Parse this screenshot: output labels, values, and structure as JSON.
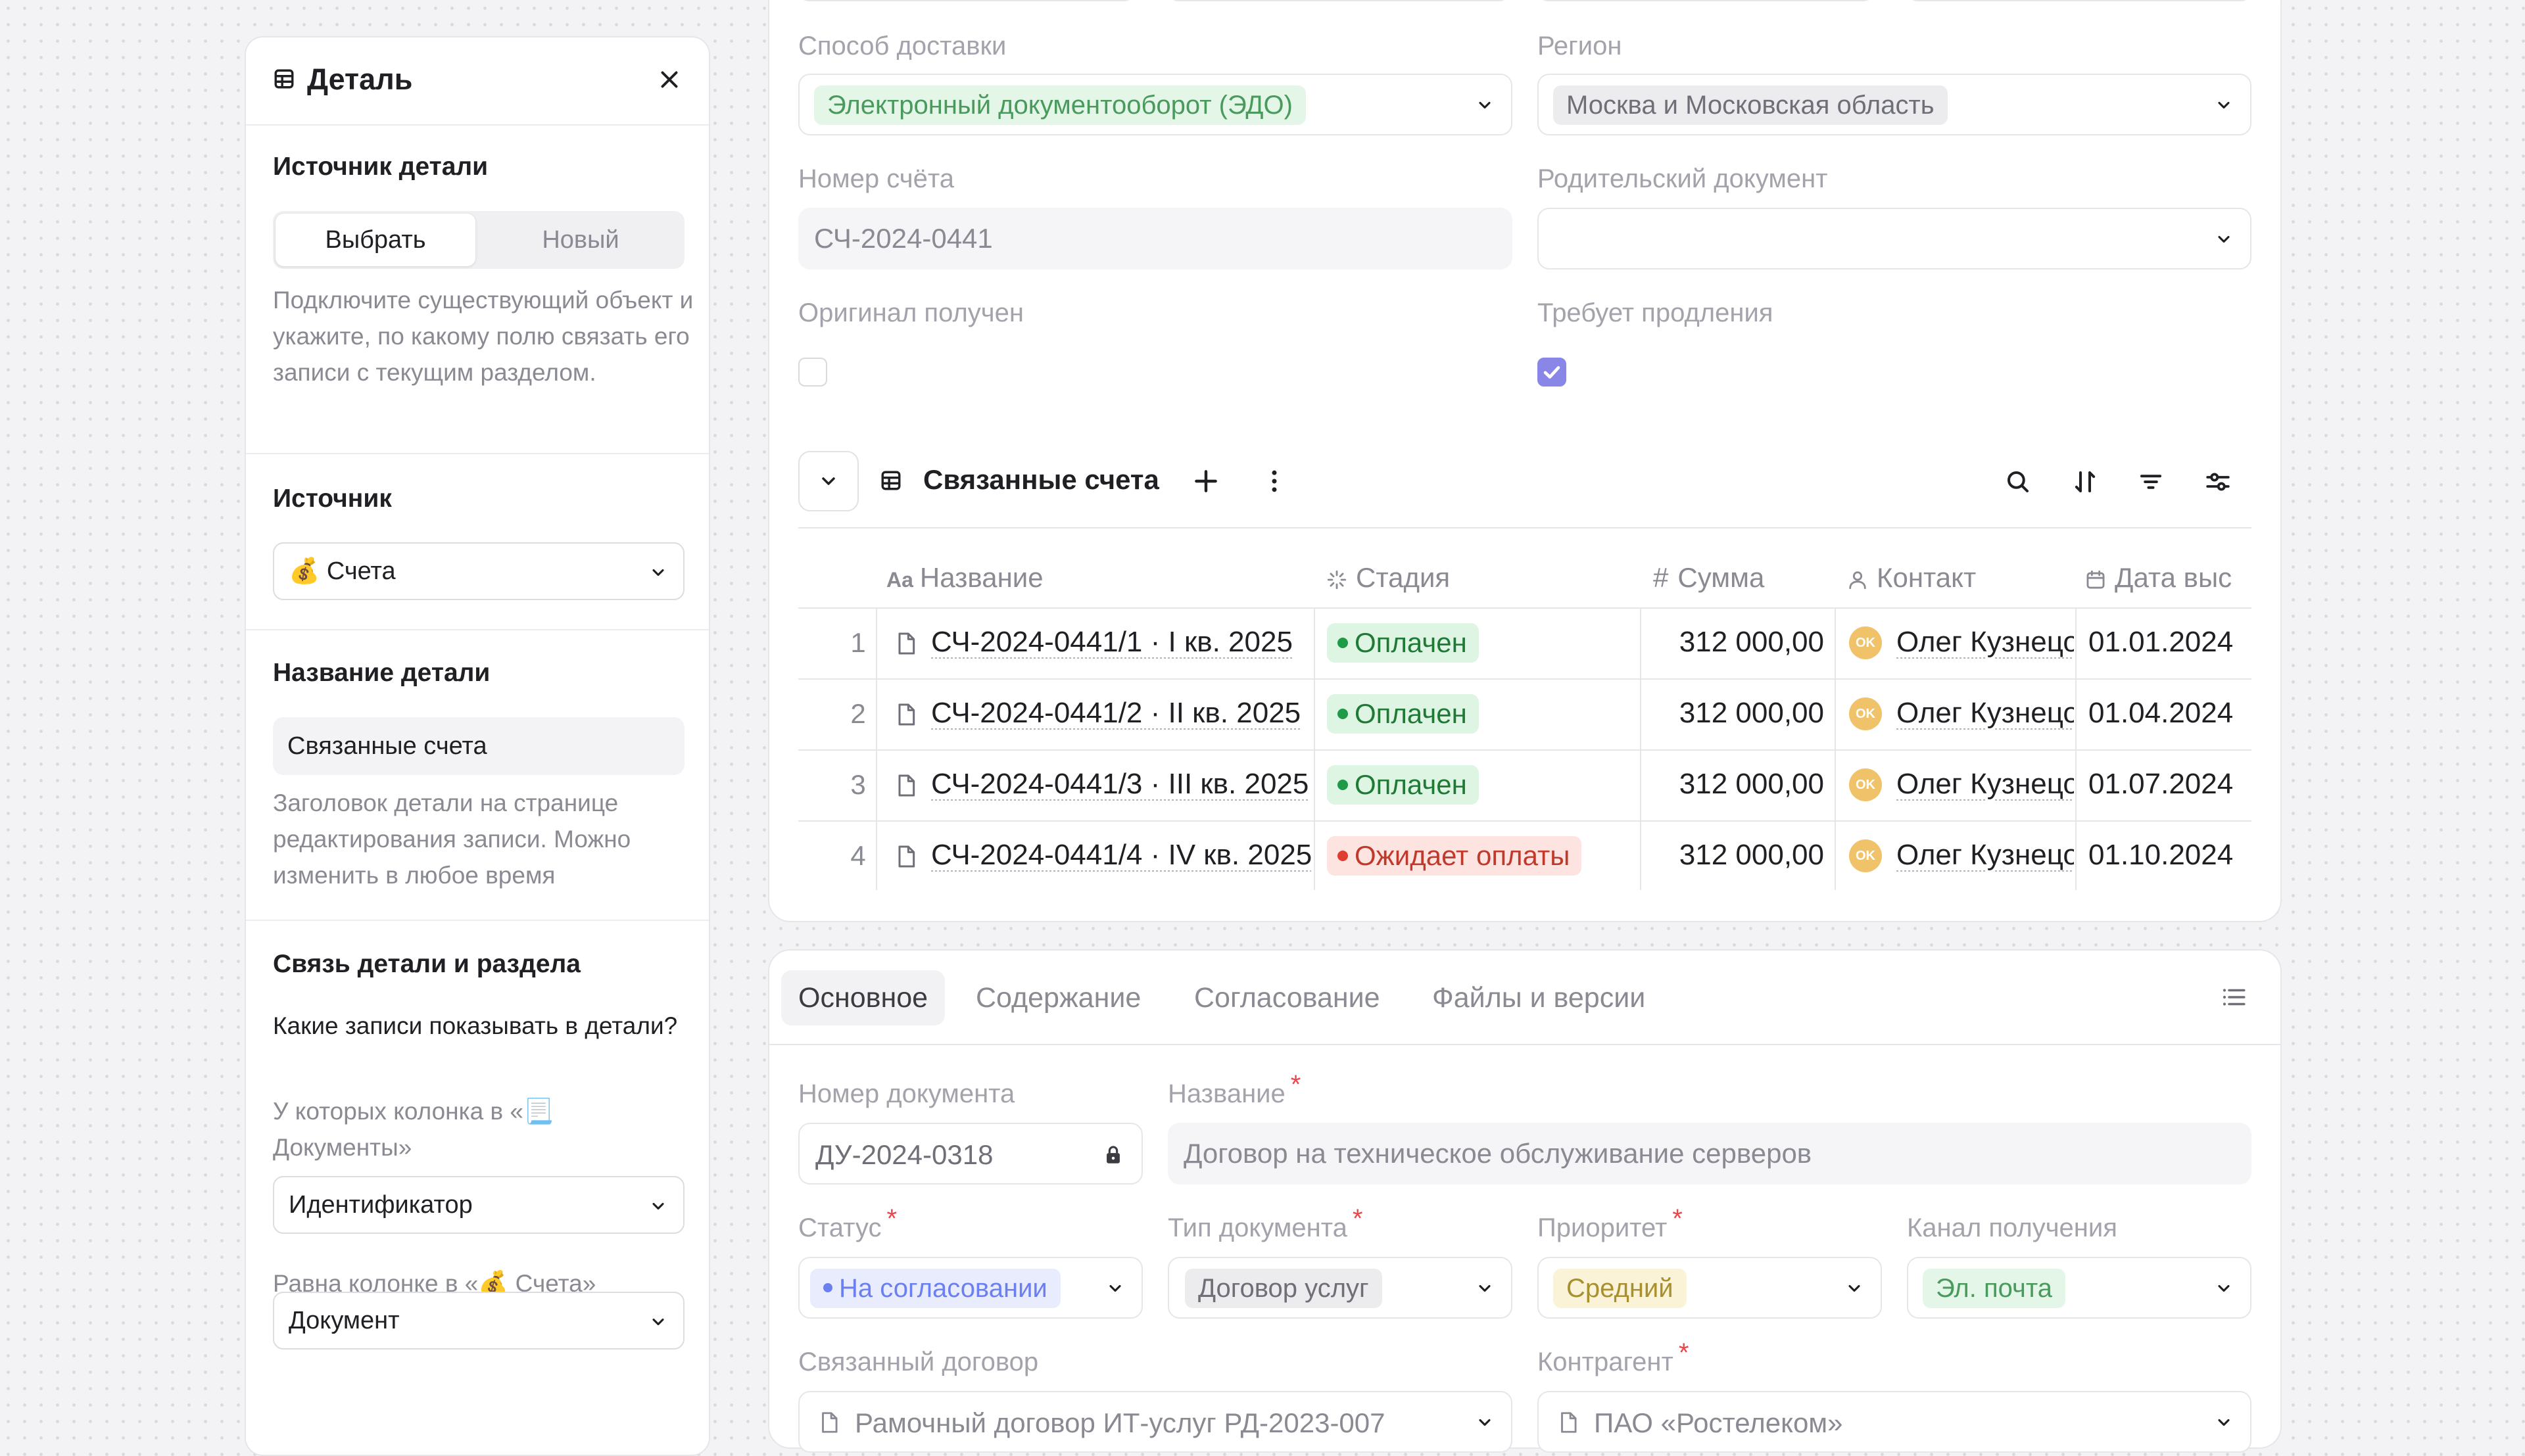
{
  "detail_panel": {
    "title": "Деталь",
    "source_section_label": "Источник детали",
    "source_mode_options": [
      "Выбрать",
      "Новый"
    ],
    "source_mode_help": "Подключите существующий объект и укажите, по какому полю связать его записи с текущим разделом.",
    "source_label": "Источник",
    "source_value": "💰 Счета",
    "name_label": "Название детали",
    "name_value": "Связанные счета",
    "name_help": "Заголовок детали на странице редактирования записи. Можно изменить в любое время",
    "link_label": "Связь детали и раздела",
    "link_question": "Какие записи показывать в детали?",
    "link_column_label": "У которых колонка в «📃 Документы»",
    "link_column_value": "Идентификатор",
    "link_equals_label": "Равна колонке в «💰 Счета»",
    "link_equals_value": "Документ"
  },
  "record_form": {
    "delivery_label": "Способ доставки",
    "delivery_value": "Электронный документооборот (ЭДО)",
    "region_label": "Регион",
    "region_value": "Москва и Московская область",
    "invoice_number_label": "Номер счёта",
    "invoice_number_value": "СЧ-2024-0441",
    "parent_doc_label": "Родительский документ",
    "parent_doc_value": "",
    "original_received_label": "Оригинал получен",
    "original_received_checked": false,
    "needs_extension_label": "Требует продления",
    "needs_extension_checked": true
  },
  "detail_table": {
    "title": "Связанные счета",
    "columns": [
      "Название",
      "Стадия",
      "Сумма",
      "Контакт",
      "Дата выставления"
    ],
    "columns_visible": [
      "Название",
      "Стадия",
      "Сумма",
      "Контакт",
      "Дата выс"
    ],
    "rows": [
      {
        "num": "1",
        "name": "СЧ-2024-0441/1 · I кв. 2025",
        "stage": "Оплачен",
        "sum": "312 000,00",
        "contact_initials": "OK",
        "contact": "Олег Кузнецов",
        "date": "01.01.2024"
      },
      {
        "num": "2",
        "name": "СЧ-2024-0441/2 · II кв. 2025",
        "stage": "Оплачен",
        "sum": "312 000,00",
        "contact_initials": "OK",
        "contact": "Олег Кузнецов",
        "date": "01.04.2024"
      },
      {
        "num": "3",
        "name": "СЧ-2024-0441/3 · III кв. 2025",
        "stage": "Оплачен",
        "sum": "312 000,00",
        "contact_initials": "OK",
        "contact": "Олег Кузнецов",
        "date": "01.07.2024"
      },
      {
        "num": "4",
        "name": "СЧ-2024-0441/4 · IV кв. 2025",
        "stage": "Ожидает оплаты",
        "sum": "312 000,00",
        "contact_initials": "OK",
        "contact": "Олег Кузнецов",
        "date": "01.10.2024"
      }
    ]
  },
  "main_form": {
    "tabs": [
      "Основное",
      "Содержание",
      "Согласование",
      "Файлы и версии"
    ],
    "doc_number_label": "Номер документа",
    "doc_number_value": "ДУ-2024-0318",
    "name_label": "Название",
    "name_value": "Договор на техническое обслуживание серверов",
    "status_label": "Статус",
    "status_value": "На согласовании",
    "doc_type_label": "Тип документа",
    "doc_type_value": "Договор услуг",
    "priority_label": "Приоритет",
    "priority_value": "Средний",
    "channel_label": "Канал получения",
    "channel_value": "Эл. почта",
    "linked_contract_label": "Связанный договор",
    "linked_contract_value": "Рамочный договор ИТ-услуг РД-2023-007",
    "counterparty_label": "Контрагент",
    "counterparty_value": "ПАО «Ростелеком»",
    "required_mark": "*"
  },
  "colors": {
    "accent": "#8a86e8",
    "paid_bg": "#dff5e4",
    "paid_text": "#1f7a36",
    "waiting_bg": "#fde4e0",
    "waiting_text": "#c0392b"
  }
}
